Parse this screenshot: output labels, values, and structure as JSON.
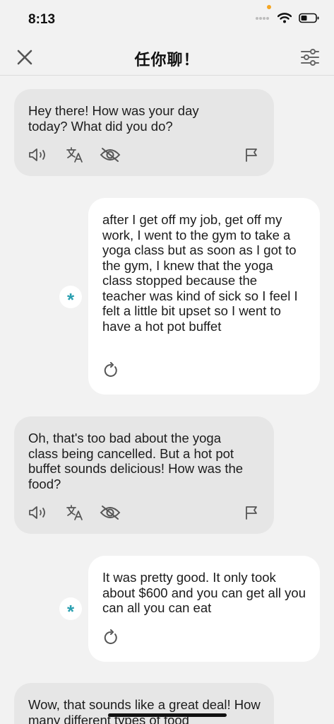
{
  "status": {
    "time": "8:13"
  },
  "header": {
    "title": "任你聊！"
  },
  "messages": [
    {
      "role": "ai",
      "text": "Hey there! How was your day today? What did you do?"
    },
    {
      "role": "user",
      "text": "after I get off my job, get off my work, I went to the gym to take a yoga class but as soon as I got to the gym, I knew that the yoga class stopped because the teacher was kind of sick so I feel I felt a little bit upset so I went to have a hot pot buffet"
    },
    {
      "role": "ai",
      "text": "Oh, that's too bad about the yoga class being cancelled. But a hot pot buffet sounds delicious! How was the food?"
    },
    {
      "role": "user",
      "text": "It was pretty good. It only took about $600 and you can get all you can all you can eat"
    },
    {
      "role": "ai",
      "text": "Wow, that sounds like a great deal! How many different types of food"
    }
  ],
  "avatar_glyph": "*",
  "icons": {
    "close": "close-icon",
    "settings": "sliders-icon",
    "speaker": "speaker-icon",
    "translate": "translate-icon",
    "hide": "eye-off-icon",
    "flag": "flag-icon",
    "retry": "retry-icon"
  },
  "colors": {
    "background": "#f2f2f2",
    "ai_bubble": "#e6e6e6",
    "user_bubble": "#ffffff",
    "accent": "#2a9fb0"
  }
}
